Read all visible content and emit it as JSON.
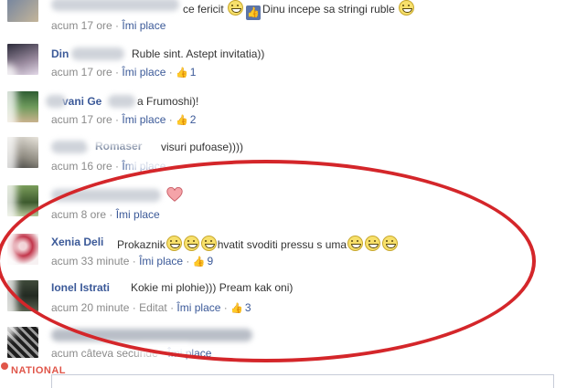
{
  "comments": [
    {
      "text_part1": "ce fericit",
      "text_part2": "Dinu incepe sa stringi ruble",
      "time": "acum 17 ore",
      "like_label": "Îmi place",
      "likes": ""
    },
    {
      "name": "Din",
      "text": "Ruble sint. Astept invitatia))",
      "time": "acum 17 ore",
      "like_label": "Îmi place",
      "likes": "1"
    },
    {
      "name": "vani Ge",
      "text": "a Frumoshi)!",
      "time": "acum 17 ore",
      "like_label": "Îmi place",
      "likes": "2"
    },
    {
      "name": "Romaser",
      "text": "visuri pufoase))))",
      "time": "acum 16 ore",
      "like_label": "Îmi place",
      "likes": ""
    },
    {
      "name": "",
      "text": "",
      "time": "acum 8 ore",
      "like_label": "Îmi place",
      "likes": ""
    },
    {
      "name": "Xenia Deli",
      "text_part1": "Prokaznik",
      "text_part2": "hvatit svoditi pressu s uma",
      "time": "acum 33 minute",
      "like_label": "Îmi place",
      "likes": "9"
    },
    {
      "name": "Ionel Istrati",
      "text": "Kokie mi plohie))) Pream kak oni)",
      "time": "acum 20 minute",
      "edited_label": "Editat",
      "like_label": "Îmi place",
      "likes": "3"
    },
    {
      "name": "",
      "text": "",
      "time": "acum câteva secunde",
      "like_label": "Îmi place",
      "likes": ""
    }
  ],
  "watermark": "NATIONAL",
  "colors": {
    "link": "#3b5998",
    "meta": "#8a8a8a",
    "annotation_oval": "#d4262a"
  },
  "icons": [
    "thumbs-up-icon",
    "smiley-emoji-icon",
    "heart-emoji-icon"
  ]
}
